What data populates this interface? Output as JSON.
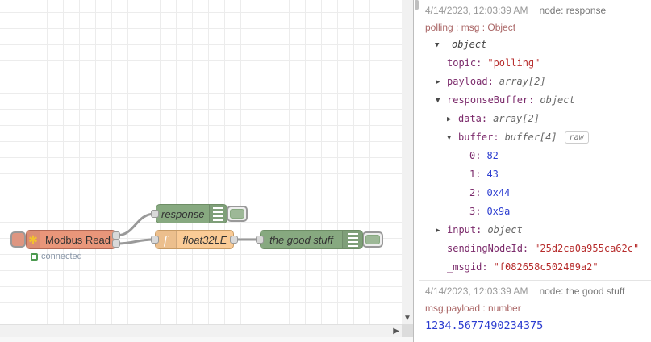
{
  "flow": {
    "nodes": {
      "modbus_read": {
        "label": "Modbus Read",
        "status": "connected"
      },
      "response": {
        "label": "response"
      },
      "float32le": {
        "label": "float32LE"
      },
      "the_good_stuff": {
        "label": "the good stuff"
      }
    },
    "icons": {
      "modbus_icon": "✱",
      "function_icon": "ƒ",
      "scroll_down_icon": "▼",
      "scroll_right_icon": "▶"
    }
  },
  "debug": {
    "raw_label": "raw",
    "messages": [
      {
        "timestamp": "4/14/2023, 12:03:39 AM",
        "node_label": "node: response",
        "topic": "polling : msg : Object",
        "tree": [
          {
            "arrow": "▼",
            "key": "",
            "value": "object",
            "vclass": "val-object"
          },
          {
            "arrow": "",
            "key": "topic:",
            "value": "\"polling\"",
            "vclass": "val-string"
          },
          {
            "arrow": "▶",
            "key": "payload:",
            "value": "array[2]",
            "vclass": "val-type"
          },
          {
            "arrow": "▼",
            "key": "responseBuffer:",
            "value": "object",
            "vclass": "val-type"
          },
          {
            "arrow": "▶",
            "key": "data:",
            "value": "array[2]",
            "vclass": "val-type"
          },
          {
            "arrow": "▼",
            "key": "buffer:",
            "value": "buffer[4]",
            "vclass": "val-type"
          },
          {
            "arrow": "",
            "key": "0:",
            "value": "82",
            "vclass": "val-number"
          },
          {
            "arrow": "",
            "key": "1:",
            "value": "43",
            "vclass": "val-number"
          },
          {
            "arrow": "",
            "key": "2:",
            "value": "0x44",
            "vclass": "val-number"
          },
          {
            "arrow": "",
            "key": "3:",
            "value": "0x9a",
            "vclass": "val-number"
          },
          {
            "arrow": "▶",
            "key": "input:",
            "value": "object",
            "vclass": "val-type"
          },
          {
            "arrow": "",
            "key": "sendingNodeId:",
            "value": "\"25d2ca0a955ca62c\"",
            "vclass": "val-string"
          },
          {
            "arrow": "",
            "key": "_msgid:",
            "value": "\"f082658c502489a2\"",
            "vclass": "val-string"
          }
        ]
      },
      {
        "timestamp": "4/14/2023, 12:03:39 AM",
        "node_label": "node: the good stuff",
        "topic": "msg.payload : number",
        "value": "1234.5677490234375"
      }
    ]
  }
}
